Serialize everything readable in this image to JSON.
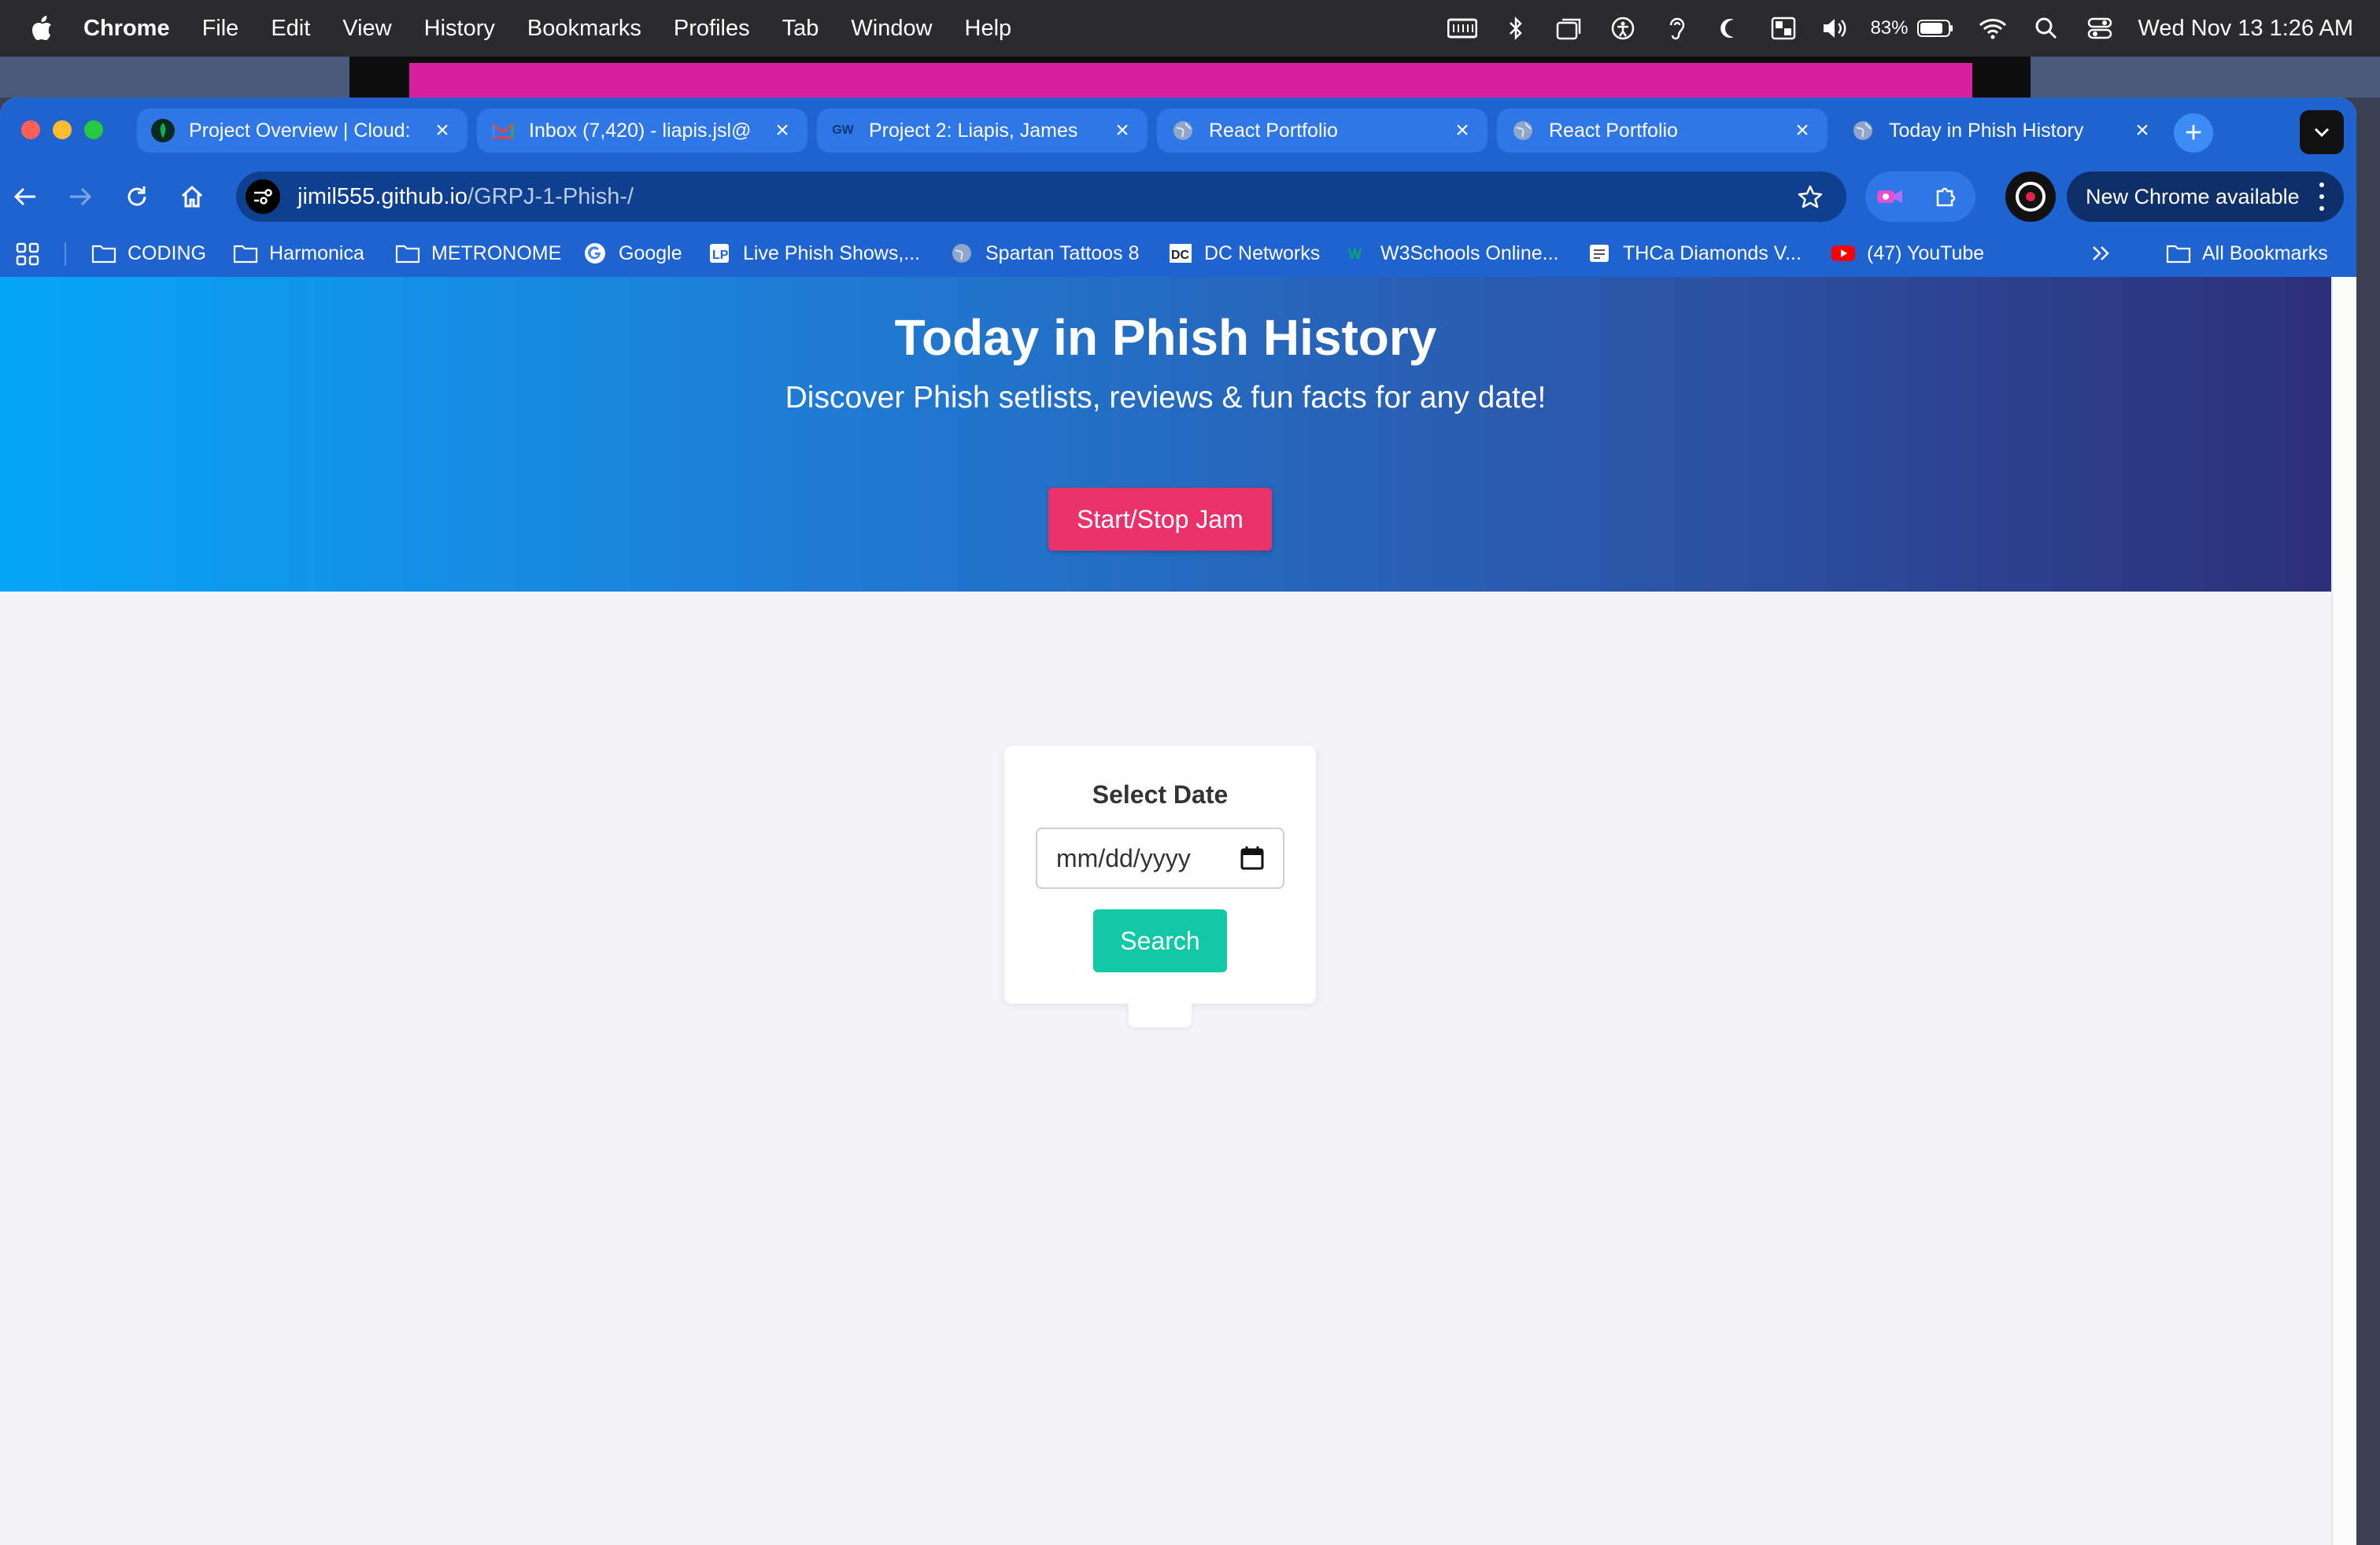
{
  "menubar": {
    "app_name": "Chrome",
    "items": [
      "File",
      "Edit",
      "View",
      "History",
      "Bookmarks",
      "Profiles",
      "Tab",
      "Window",
      "Help"
    ],
    "battery": "83%",
    "datetime": "Wed Nov 13  1:26 AM"
  },
  "tabs": [
    {
      "label": "Project Overview | Cloud:",
      "favicon": "mongodb-leaf-icon",
      "active": false
    },
    {
      "label": "Inbox (7,420) - liapis.jsl@",
      "favicon": "gmail-icon",
      "active": false
    },
    {
      "label": "Project 2: Liapis, James",
      "favicon": "gw-icon",
      "active": false
    },
    {
      "label": "React Portfolio",
      "favicon": "globe-icon",
      "active": false
    },
    {
      "label": "React Portfolio",
      "favicon": "globe-icon",
      "active": false
    },
    {
      "label": "Today in Phish History",
      "favicon": "globe-icon",
      "active": true
    }
  ],
  "omnibox": {
    "host": "jimil555.github.io",
    "path": "/GRPJ-1-Phish-/"
  },
  "update_button": "New Chrome available",
  "bookmarks": [
    {
      "label": "CODING",
      "icon": "folder-icon"
    },
    {
      "label": "Harmonica",
      "icon": "folder-icon"
    },
    {
      "label": "METRONOME",
      "icon": "folder-icon"
    },
    {
      "label": "Google",
      "icon": "google-icon"
    },
    {
      "label": "Live Phish Shows,...",
      "icon": "livephish-icon"
    },
    {
      "label": "Spartan Tattoos 8",
      "icon": "globe-icon"
    },
    {
      "label": "DC Networks",
      "icon": "dc-icon"
    },
    {
      "label": "W3Schools Online...",
      "icon": "w3schools-icon"
    },
    {
      "label": "THCa Diamonds V...",
      "icon": "site-icon"
    },
    {
      "label": "(47) YouTube",
      "icon": "youtube-icon"
    }
  ],
  "all_bookmarks": "All Bookmarks",
  "page": {
    "title": "Today in Phish History",
    "subtitle": "Discover Phish setlists, reviews & fun facts for any date!",
    "jam_button": "Start/Stop Jam",
    "card_title": "Select Date",
    "date_placeholder": "mm/dd/yyyy",
    "search_button": "Search"
  },
  "colors": {
    "chrome_blue": "#1e63d0",
    "jam_button": "#e9326a",
    "search_button": "#12c9a6"
  }
}
